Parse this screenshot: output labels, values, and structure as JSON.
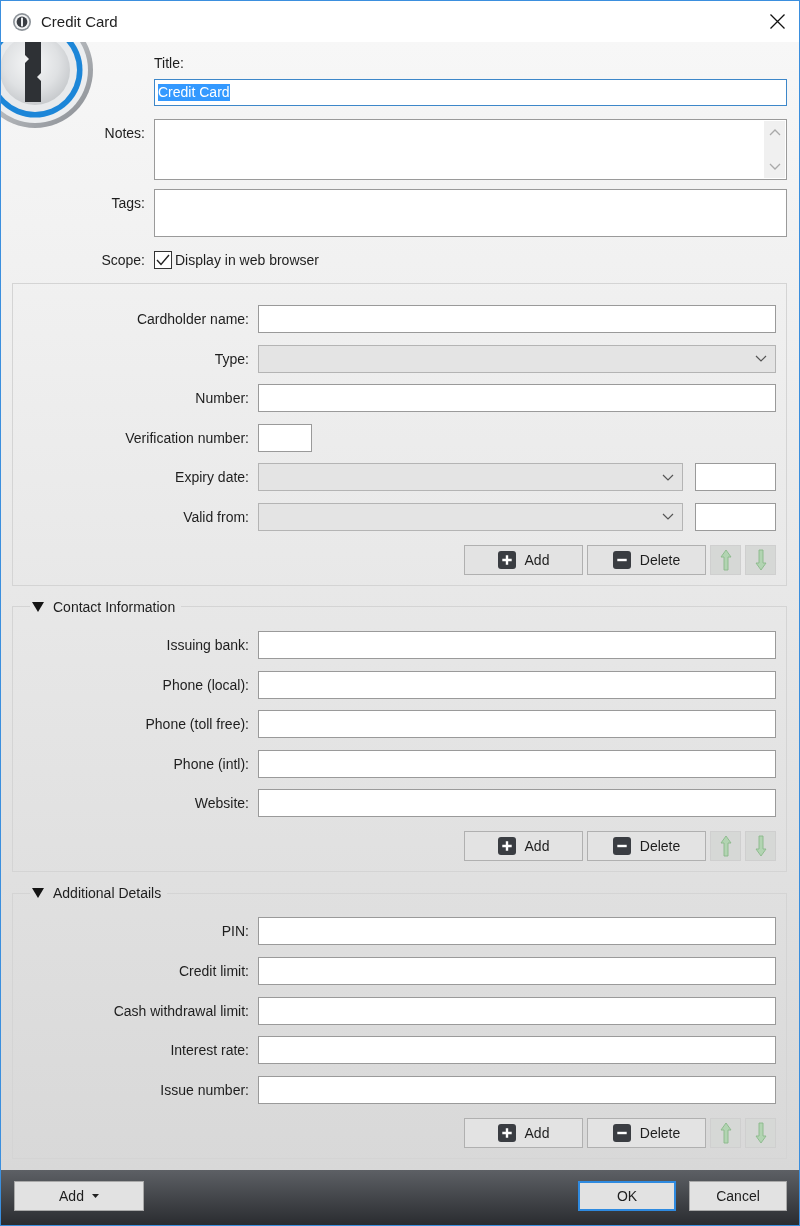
{
  "window": {
    "title": "Credit Card"
  },
  "item": {
    "title": {
      "label": "Title:",
      "value": "Credit Card",
      "focused": true,
      "text_selected": true
    },
    "notes": {
      "label": "Notes:"
    },
    "tags": {
      "label": "Tags:"
    },
    "scope": {
      "label": "Scope:",
      "option": "Display in web browser",
      "checked": true
    }
  },
  "sections": [
    {
      "fields": [
        {
          "label": "Cardholder name:",
          "kind": "text"
        },
        {
          "label": "Type:",
          "kind": "dropdown"
        },
        {
          "label": "Number:",
          "kind": "text"
        },
        {
          "label": "Verification number:",
          "kind": "short"
        },
        {
          "label": "Expiry date:",
          "kind": "dropdown_text"
        },
        {
          "label": "Valid from:",
          "kind": "dropdown_text"
        }
      ],
      "buttons": [
        {
          "kind": "add",
          "label": "Add"
        },
        {
          "kind": "delete",
          "label": "Delete"
        },
        {
          "kind": "move_up",
          "disabled": true
        },
        {
          "kind": "move_down",
          "disabled": true
        }
      ]
    },
    {
      "title": "Contact Information",
      "expanded": true,
      "fields": [
        {
          "label": "Issuing bank:",
          "kind": "text"
        },
        {
          "label": "Phone (local):",
          "kind": "text"
        },
        {
          "label": "Phone (toll free):",
          "kind": "text"
        },
        {
          "label": "Phone (intl):",
          "kind": "text"
        },
        {
          "label": "Website:",
          "kind": "text"
        }
      ],
      "buttons": [
        {
          "kind": "add",
          "label": "Add"
        },
        {
          "kind": "delete",
          "label": "Delete"
        },
        {
          "kind": "move_up",
          "disabled": true
        },
        {
          "kind": "move_down",
          "disabled": true
        }
      ]
    },
    {
      "title": "Additional Details",
      "expanded": true,
      "fields": [
        {
          "label": "PIN:",
          "kind": "text"
        },
        {
          "label": "Credit limit:",
          "kind": "text"
        },
        {
          "label": "Cash withdrawal limit:",
          "kind": "text"
        },
        {
          "label": "Interest rate:",
          "kind": "text"
        },
        {
          "label": "Issue number:",
          "kind": "text"
        }
      ],
      "buttons": [
        {
          "kind": "add",
          "label": "Add"
        },
        {
          "kind": "delete",
          "label": "Delete"
        },
        {
          "kind": "move_up",
          "disabled": true
        },
        {
          "kind": "move_down",
          "disabled": true
        }
      ]
    }
  ],
  "footer": {
    "buttons": [
      {
        "kind": "menu",
        "label": "Add",
        "default": false
      },
      {
        "kind": "plain",
        "label": "OK",
        "default": true
      },
      {
        "kind": "plain",
        "label": "Cancel",
        "default": false
      }
    ]
  }
}
